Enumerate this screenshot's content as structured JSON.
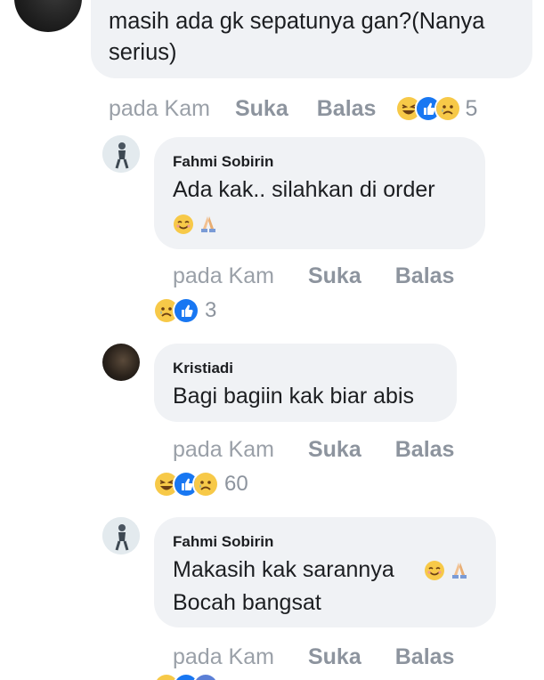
{
  "comments": [
    {
      "text_lines": [
        "masih ada gk sepatunya gan?(Nanya",
        "serius)"
      ],
      "time": "pada Kam",
      "like_label": "Suka",
      "reply_label": "Balas",
      "reactions": [
        "haha-icon",
        "like-icon",
        "sad-icon"
      ],
      "reaction_count": "5"
    },
    {
      "author": "Fahmi Sobirin",
      "text_lines": [
        "Ada kak..  silahkan di order"
      ],
      "inline_emoji": [
        "smiling-face-icon",
        "folded-hands-icon"
      ],
      "time": "pada Kam",
      "like_label": "Suka",
      "reply_label": "Balas",
      "reactions": [
        "sad-icon",
        "like-icon"
      ],
      "reaction_count": "3"
    },
    {
      "author": "Kristiadi",
      "text_lines": [
        "Bagi bagiin kak biar abis"
      ],
      "time": "pada Kam",
      "like_label": "Suka",
      "reply_label": "Balas",
      "reactions": [
        "haha-icon",
        "like-icon",
        "sad-icon"
      ],
      "reaction_count": "60"
    },
    {
      "author": "Fahmi Sobirin",
      "text_lines": [
        "Makasih kak sarannya",
        "Bocah bangsat"
      ],
      "inline_emoji": [
        "smiling-face-icon",
        "folded-hands-icon"
      ],
      "time": "pada Kam",
      "like_label": "Suka",
      "reply_label": "Balas"
    }
  ],
  "colors": {
    "bubble": "#f0f2f5",
    "meta_text": "#8d949e",
    "like_blue": "#1877f2",
    "emoji_yellow": "#f7c948"
  }
}
